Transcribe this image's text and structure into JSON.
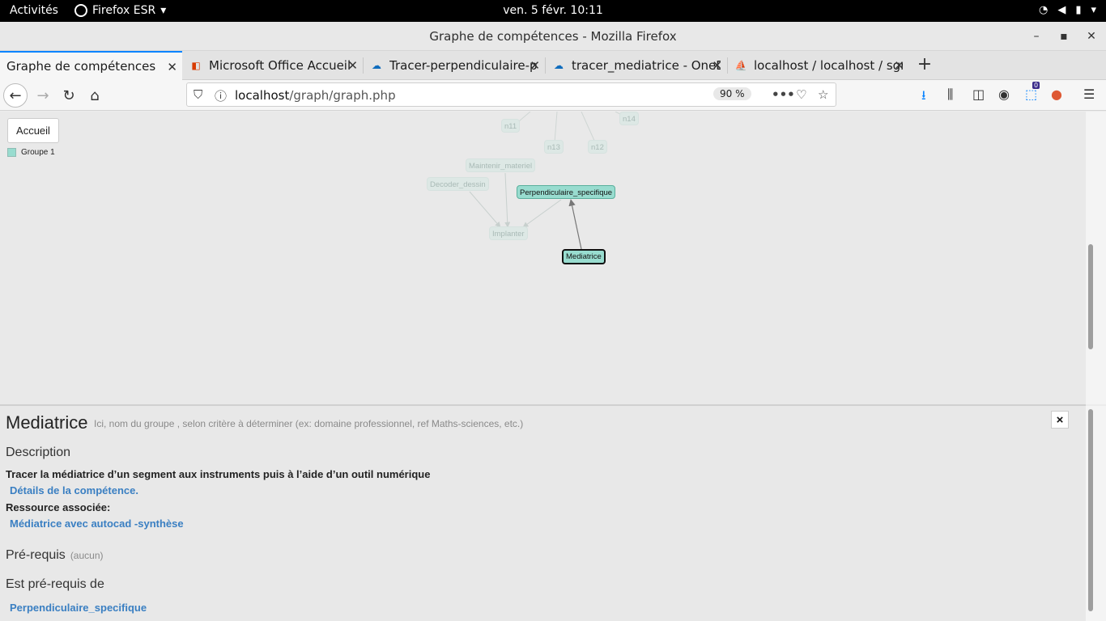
{
  "system_bar": {
    "activities": "Activités",
    "app_name": "Firefox ESR",
    "clock": "ven. 5 févr.  10:11"
  },
  "window": {
    "title": "Graphe de compétences - Mozilla Firefox"
  },
  "tabs": [
    {
      "label": "Graphe de compétences",
      "icon": "none",
      "active": true
    },
    {
      "label": "Microsoft Office Accueil",
      "icon": "office-icon",
      "active": false
    },
    {
      "label": "Tracer-perpendiculaire-p",
      "icon": "onedrive-icon",
      "active": false
    },
    {
      "label": "tracer_mediatrice - OneD",
      "icon": "onedrive-icon",
      "active": false
    },
    {
      "label": "localhost / localhost / sgr",
      "icon": "phpmyadmin-icon",
      "active": false
    }
  ],
  "navbar": {
    "url_host": "localhost",
    "url_path": "/graph/graph.php",
    "zoom": "90 %",
    "notification_count": "0"
  },
  "page": {
    "home_button": "Accueil",
    "legend": [
      {
        "label": "Groupe 1",
        "color": "#98dccf"
      }
    ],
    "graph_nodes": [
      {
        "id": "n11",
        "label": "n11",
        "state": "faded"
      },
      {
        "id": "n13",
        "label": "n13",
        "state": "faded"
      },
      {
        "id": "n12",
        "label": "n12",
        "state": "faded"
      },
      {
        "id": "n14",
        "label": "n14",
        "state": "faded"
      },
      {
        "id": "maintenir",
        "label": "Maintenir_materiel",
        "state": "faded"
      },
      {
        "id": "decoder",
        "label": "Decoder_dessin",
        "state": "faded"
      },
      {
        "id": "implanter",
        "label": "Implanter",
        "state": "faded"
      },
      {
        "id": "perp",
        "label": "Perpendiculaire_specifique",
        "state": "solid"
      },
      {
        "id": "med",
        "label": "Mediatrice",
        "state": "selected"
      }
    ],
    "details": {
      "title": "Mediatrice",
      "group_hint": "Ici, nom du groupe , selon critère à déterminer (ex: domaine professionnel, ref Maths-sciences, etc.)",
      "description_heading": "Description",
      "description_text": "Tracer la médiatrice d’un segment aux instruments puis à l’aide d’un outil numérique",
      "details_link": "Détails de la compétence.",
      "resource_label": "Ressource associée:",
      "resource_link": "Médiatrice avec autocad -synthèse",
      "prereq_heading": "Pré-requis",
      "prereq_none": "(aucun)",
      "is_prereq_heading": "Est pré-requis de",
      "is_prereq_link": "Perpendiculaire_specifique",
      "close_label": "×"
    }
  }
}
